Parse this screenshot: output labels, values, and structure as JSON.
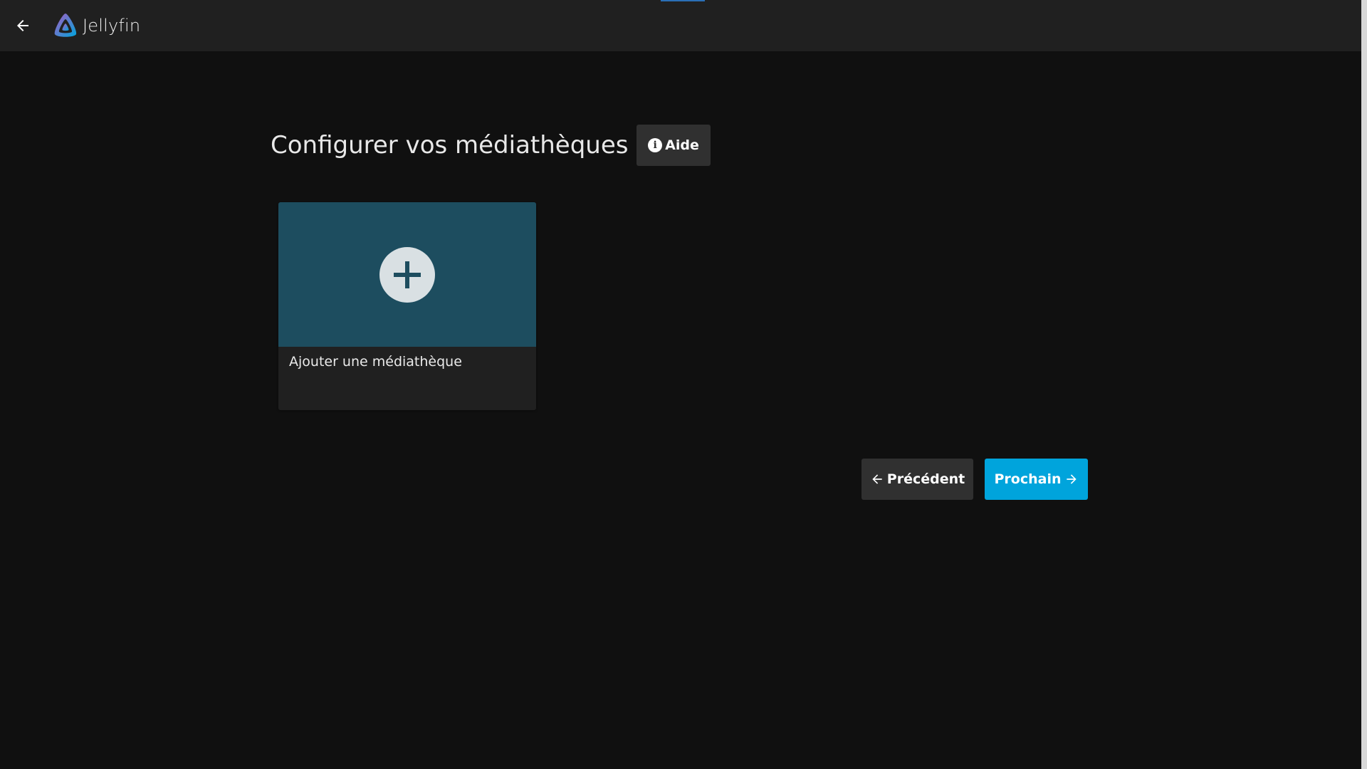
{
  "header": {
    "app_name": "Jellyfin",
    "icons": {
      "back": "arrow-left-icon",
      "logo": "jellyfin-logo-icon"
    }
  },
  "main": {
    "title": "Configurer vos médiathèques",
    "help_button": {
      "label": "Aide",
      "icon": "info-icon"
    },
    "add_library_card": {
      "label": "Ajouter une médiathèque",
      "icon": "plus-icon"
    }
  },
  "navigation": {
    "previous_label": "Précédent",
    "next_label": "Prochain"
  },
  "colors": {
    "accent": "#00a4dc",
    "background": "#101010",
    "header": "#202020",
    "card_image": "#1d4d5f",
    "button_secondary": "#303030"
  }
}
